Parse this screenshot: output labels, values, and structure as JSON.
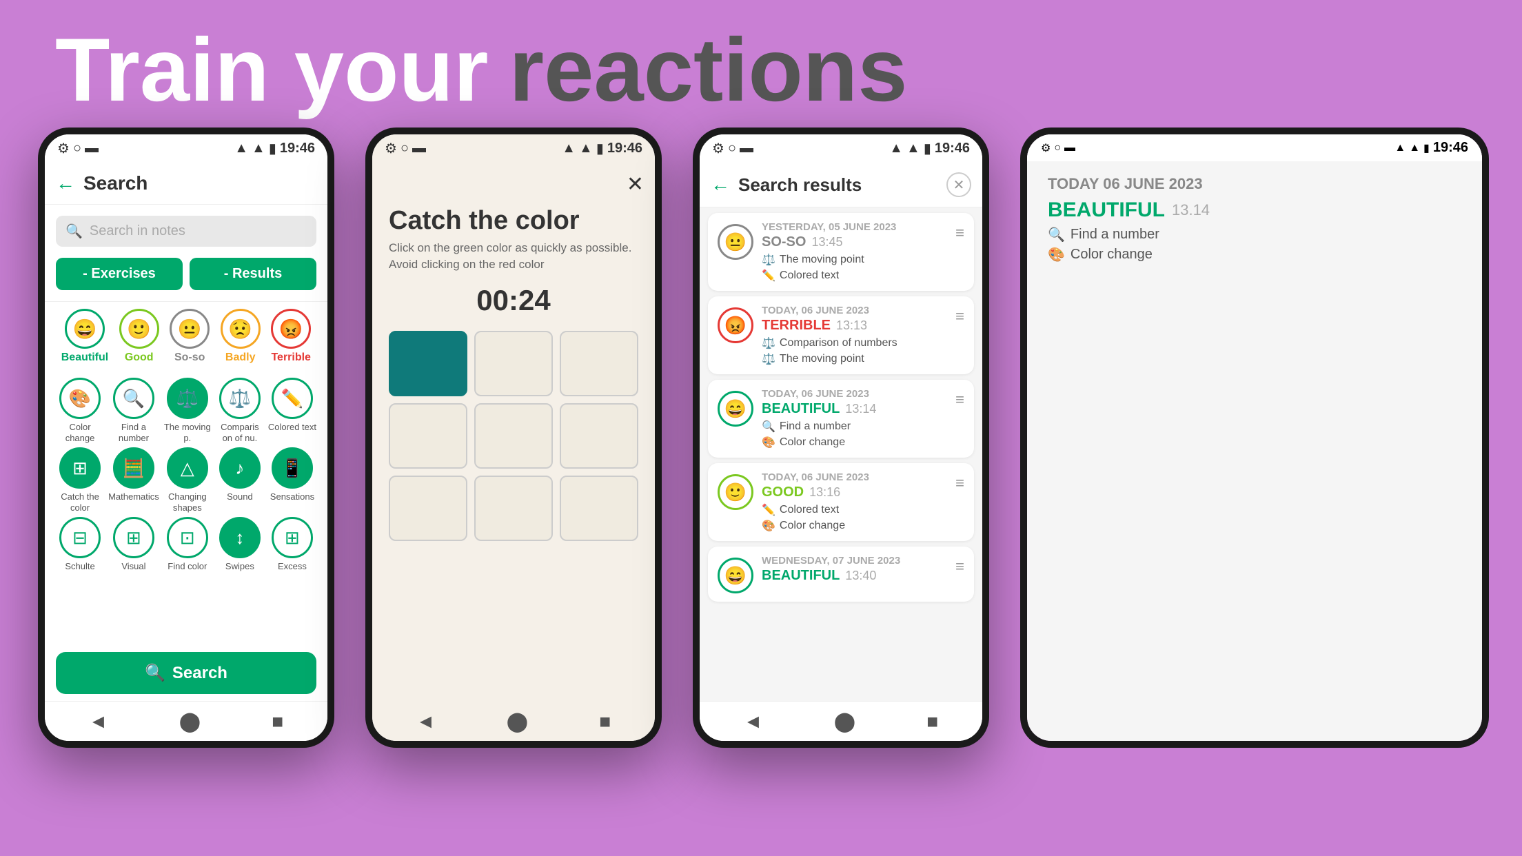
{
  "headline": {
    "part1": "Train your",
    "part2": "reactions"
  },
  "phone1": {
    "status_time": "19:46",
    "header_title": "Search",
    "search_placeholder": "Search in notes",
    "filter_exercises": "- Exercises",
    "filter_results": "- Results",
    "moods": [
      {
        "label": "Beautiful",
        "emoji": "😄",
        "color": "beautiful"
      },
      {
        "label": "Good",
        "emoji": "🙂",
        "color": "good"
      },
      {
        "label": "So-so",
        "emoji": "😐",
        "color": "soso"
      },
      {
        "label": "Badly",
        "emoji": "😟",
        "color": "badly"
      },
      {
        "label": "Terrible",
        "emoji": "😡",
        "color": "terrible"
      }
    ],
    "exercises": [
      {
        "label": "Color change",
        "emoji": "🎨",
        "filled": false
      },
      {
        "label": "Find a number",
        "emoji": "🔍",
        "filled": false
      },
      {
        "label": "The moving p.",
        "emoji": "⚖️",
        "filled": true
      },
      {
        "label": "Comparis on of nu.",
        "emoji": "⚖️",
        "filled": false
      },
      {
        "label": "Colored text",
        "emoji": "✏️",
        "filled": false
      },
      {
        "label": "Catch the color",
        "emoji": "⊞",
        "filled": true
      },
      {
        "label": "Mathematics",
        "emoji": "🧮",
        "filled": true
      },
      {
        "label": "Changing shapes",
        "emoji": "△",
        "filled": true
      },
      {
        "label": "Sound",
        "emoji": "♪",
        "filled": true
      },
      {
        "label": "Sensations",
        "emoji": "📱",
        "filled": true
      },
      {
        "label": "Schulte",
        "emoji": "⊟",
        "filled": false
      },
      {
        "label": "Visual",
        "emoji": "⊞",
        "filled": false
      },
      {
        "label": "Find color",
        "emoji": "⊡",
        "filled": false
      },
      {
        "label": "Swipes",
        "emoji": "↕",
        "filled": true
      },
      {
        "label": "Excess",
        "emoji": "⊞",
        "filled": false
      }
    ],
    "search_btn": "Search"
  },
  "phone2": {
    "status_time": "19:46",
    "game_title": "Catch the color",
    "game_desc": "Click on the green color as quickly as possible. Avoid clicking on the red color",
    "timer": "00:24",
    "grid": [
      {
        "teal": true
      },
      {
        "teal": false
      },
      {
        "teal": false
      },
      {
        "teal": false
      },
      {
        "teal": false
      },
      {
        "teal": false
      },
      {
        "teal": false
      },
      {
        "teal": false
      },
      {
        "teal": false
      }
    ]
  },
  "phone3": {
    "status_time": "19:46",
    "header_title": "Search results",
    "results": [
      {
        "date": "YESTERDAY, 05 JUNE 2023",
        "mood": "SO-SO",
        "mood_color": "soso",
        "time": "13:45",
        "exercises": [
          "The moving point",
          "Colored text"
        ]
      },
      {
        "date": "TODAY, 06 JUNE 2023",
        "mood": "TERRIBLE",
        "mood_color": "terrible",
        "time": "13:13",
        "exercises": [
          "Comparison of numbers",
          "The moving point"
        ]
      },
      {
        "date": "TODAY, 06 JUNE 2023",
        "mood": "BEAUTIFUL",
        "mood_color": "beautiful",
        "time": "13:14",
        "exercises": [
          "Find a number",
          "Color change"
        ]
      },
      {
        "date": "TODAY, 06 JUNE 2023",
        "mood": "GOOD",
        "mood_color": "good",
        "time": "13:16",
        "exercises": [
          "Colored text",
          "Color change"
        ]
      },
      {
        "date": "WEDNESDAY, 07 JUNE 2023",
        "mood": "BEAUTIFUL",
        "mood_color": "beautiful",
        "time": "13:40",
        "exercises": []
      }
    ]
  },
  "screenshot_panel": {
    "status_time": "19:46",
    "date": "TODAY 06 JUNE 2023",
    "mood": "BEAUTIFUL",
    "time": "13.14",
    "label": "Find & number Color change"
  },
  "icons": {
    "search": "🔍",
    "back_arrow": "←",
    "close_x": "✕",
    "nav_back": "◄",
    "nav_home": "⬤",
    "nav_square": "■",
    "menu_dots": "≡"
  }
}
